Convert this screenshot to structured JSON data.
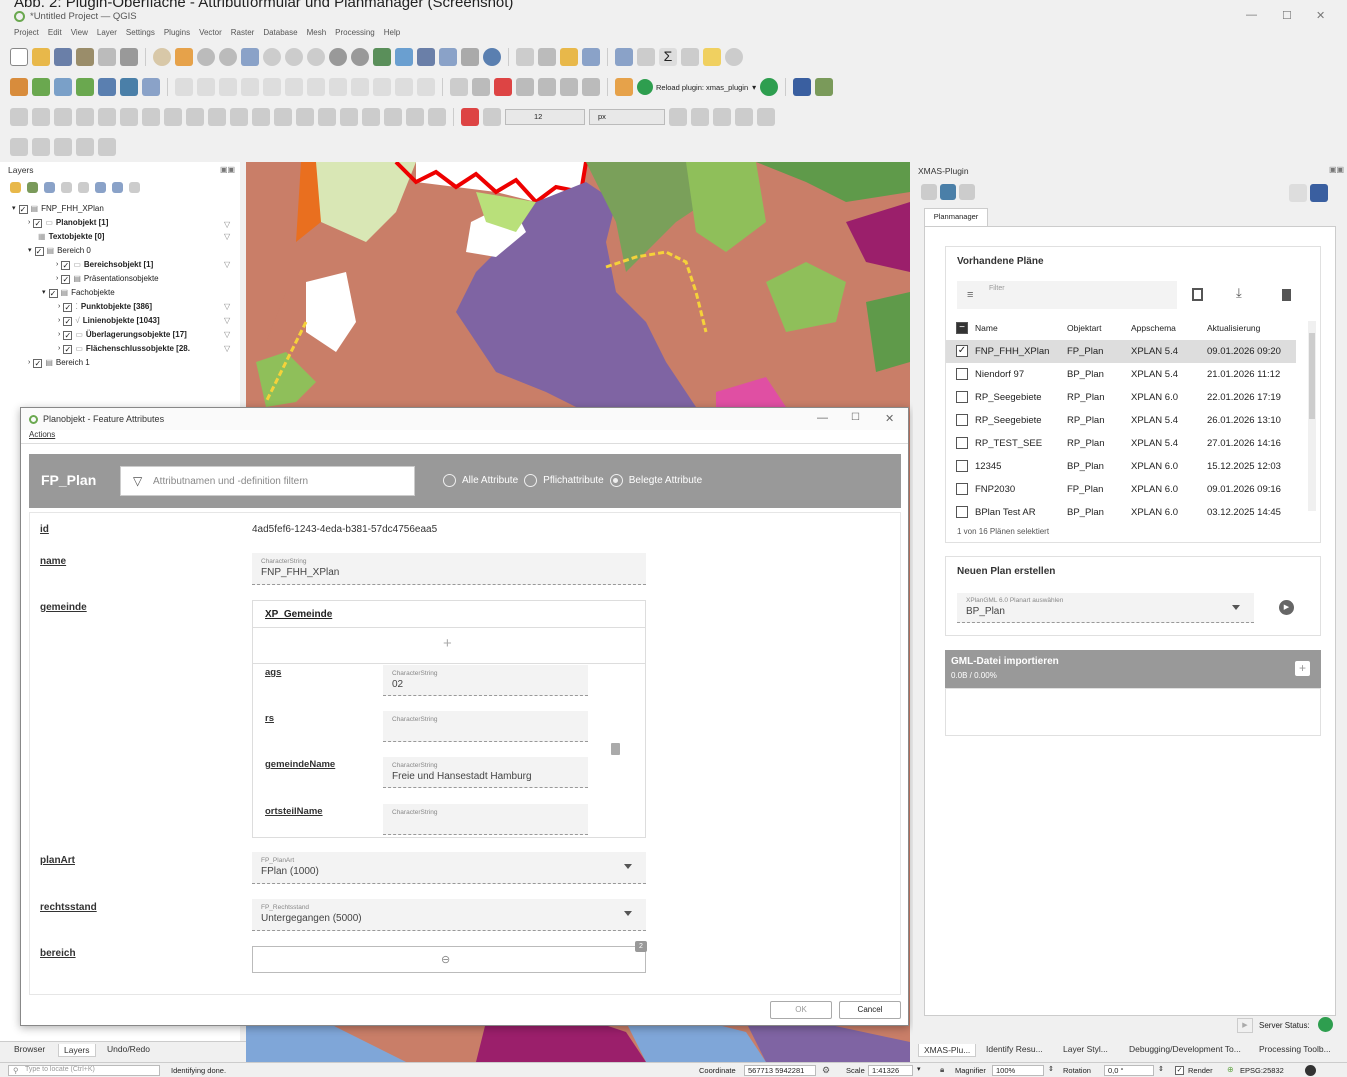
{
  "caption": "Abb. 2: Plugin-Oberfläche - Attributformular und Planmanager (Screenshot)",
  "window": {
    "title": "*Untitled Project — QGIS"
  },
  "menu": [
    "Project",
    "Edit",
    "View",
    "Layer",
    "Settings",
    "Plugins",
    "Vector",
    "Raster",
    "Database",
    "Mesh",
    "Processing",
    "Help"
  ],
  "toolbar": {
    "reload_label": "Reload plugin: xmas_plugin",
    "font_size": "12",
    "font_unit": "px"
  },
  "layers": {
    "title": "Layers",
    "items": [
      {
        "label": "FNP_FHH_XPlan",
        "bold": false,
        "indent": 0
      },
      {
        "label": "Planobjekt [1]",
        "bold": true,
        "indent": 1
      },
      {
        "label": "Textobjekte [0]",
        "bold": true,
        "indent": 1
      },
      {
        "label": "Bereich 0",
        "bold": false,
        "indent": 1
      },
      {
        "label": "Bereichsobjekt [1]",
        "bold": true,
        "indent": 2
      },
      {
        "label": "Präsentationsobjekte",
        "bold": false,
        "indent": 2
      },
      {
        "label": "Fachobjekte",
        "bold": false,
        "indent": 2
      },
      {
        "label": "Punktobjekte [386]",
        "bold": true,
        "indent": 3
      },
      {
        "label": "Linienobjekte [1043]",
        "bold": true,
        "indent": 3
      },
      {
        "label": "Überlagerungsobjekte [17]",
        "bold": true,
        "indent": 3
      },
      {
        "label": "Flächenschlussobjekte [28.",
        "bold": true,
        "indent": 3
      },
      {
        "label": "Bereich 1",
        "bold": false,
        "indent": 1
      }
    ]
  },
  "dialog": {
    "title": "Planobjekt - Feature Attributes",
    "menu": "Actions",
    "class_name": "FP_Plan",
    "filter_placeholder": "Attributnamen und -definition filtern",
    "radios": [
      "Alle Attribute",
      "Pflichattribute",
      "Belegte Attribute"
    ],
    "fields": {
      "id": {
        "label": "id",
        "value": "4ad5fef6-1243-4eda-b381-57dc4756eaa5"
      },
      "name": {
        "label": "name",
        "type": "CharacterString",
        "value": "FNP_FHH_XPlan"
      },
      "gemeinde": {
        "label": "gemeinde",
        "sub_title": "XP_Gemeinde",
        "add": "+",
        "sub": [
          {
            "label": "ags",
            "type": "CharacterString",
            "value": "02"
          },
          {
            "label": "rs",
            "type": "CharacterString",
            "value": ""
          },
          {
            "label": "gemeindeName",
            "type": "CharacterString",
            "value": "Freie und Hansestadt Hamburg"
          },
          {
            "label": "ortsteilName",
            "type": "CharacterString",
            "value": ""
          }
        ]
      },
      "planArt": {
        "label": "planArt",
        "type": "FP_PlanArt",
        "value": "FPlan (1000)"
      },
      "rechtsstand": {
        "label": "rechtsstand",
        "type": "FP_Rechtsstand",
        "value": "Untergegangen (5000)"
      },
      "bereich": {
        "label": "bereich",
        "count": "2"
      }
    },
    "ok": "OK",
    "cancel": "Cancel"
  },
  "xmas": {
    "title": "XMAS-Plugin",
    "tab": "Planmanager",
    "plans": {
      "title": "Vorhandene Pläne",
      "filter_placeholder": "Filter",
      "columns": [
        "Name",
        "Objektart",
        "Appschema",
        "Aktualisierung"
      ],
      "rows": [
        {
          "name": "FNP_FHH_XPlan",
          "art": "FP_Plan",
          "schema": "XPLAN 5.4",
          "date": "09.01.2026 09:20",
          "checked": true
        },
        {
          "name": "Niendorf 97",
          "art": "BP_Plan",
          "schema": "XPLAN 5.4",
          "date": "21.01.2026 11:12",
          "checked": false
        },
        {
          "name": "RP_Seegebiete",
          "art": "RP_Plan",
          "schema": "XPLAN 6.0",
          "date": "22.01.2026 17:19",
          "checked": false
        },
        {
          "name": "RP_Seegebiete",
          "art": "RP_Plan",
          "schema": "XPLAN 5.4",
          "date": "26.01.2026 13:10",
          "checked": false
        },
        {
          "name": "RP_TEST_SEE",
          "art": "RP_Plan",
          "schema": "XPLAN 5.4",
          "date": "27.01.2026 14:16",
          "checked": false
        },
        {
          "name": "12345",
          "art": "BP_Plan",
          "schema": "XPLAN 6.0",
          "date": "15.12.2025 12:03",
          "checked": false
        },
        {
          "name": "FNP2030",
          "art": "FP_Plan",
          "schema": "XPLAN 6.0",
          "date": "09.01.2026 09:16",
          "checked": false
        },
        {
          "name": "BPlan Test AR",
          "art": "BP_Plan",
          "schema": "XPLAN 6.0",
          "date": "03.12.2025 14:45",
          "checked": false
        }
      ],
      "status": "1 von 16 Plänen selektiert"
    },
    "new_plan": {
      "title": "Neuen Plan erstellen",
      "type_label": "XPlanGML 6.0 Planart auswählen",
      "value": "BP_Plan"
    },
    "gml": {
      "title": "GML-Datei importieren",
      "progress": "0.0B / 0.00%"
    },
    "server_status": "Server Status:"
  },
  "bottom_tabs_left": [
    "Browser",
    "Layers",
    "Undo/Redo"
  ],
  "bottom_tabs_right": [
    "XMAS-Plu...",
    "Identify Resu...",
    "Layer Styl...",
    "Debugging/Development To...",
    "Processing Toolb..."
  ],
  "statusbar": {
    "locate_placeholder": "Type to locate (Ctrl+K)",
    "message": "Identifying done.",
    "coordinate_label": "Coordinate",
    "coordinate": "567713 5942281",
    "scale_label": "Scale",
    "scale": "1:41326",
    "magnifier_label": "Magnifier",
    "magnifier": "100%",
    "rotation_label": "Rotation",
    "rotation": "0,0 °",
    "render": "Render",
    "crs": "EPSG:25832"
  },
  "colors": {
    "accent_green": "#2e9e4f",
    "map_base": "#c97e68",
    "water": "#7f64a3",
    "header_gray": "#999999"
  }
}
